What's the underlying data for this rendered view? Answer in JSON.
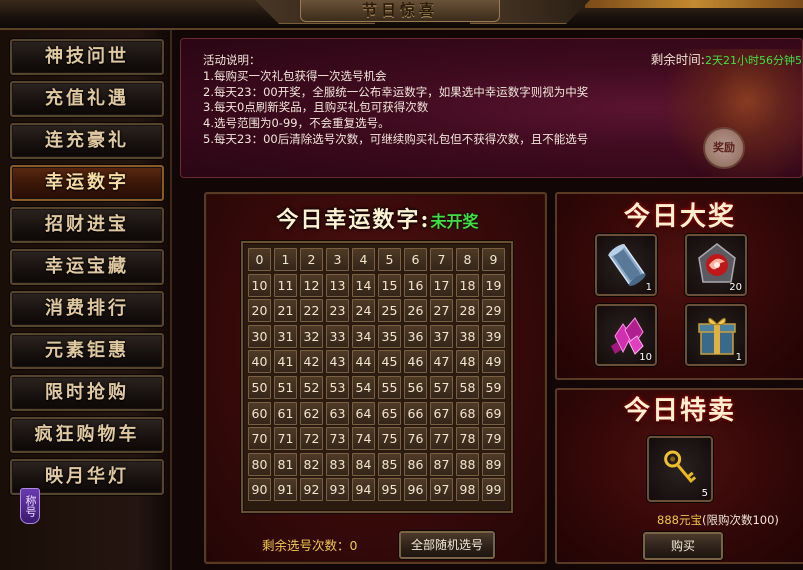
{
  "window": {
    "title": "节日惊喜"
  },
  "sidebar": {
    "items": [
      {
        "label": "神技问世"
      },
      {
        "label": "充值礼遇"
      },
      {
        "label": "连充豪礼"
      },
      {
        "label": "幸运数字"
      },
      {
        "label": "招财进宝"
      },
      {
        "label": "幸运宝藏"
      },
      {
        "label": "消费排行"
      },
      {
        "label": "元素钜惠"
      },
      {
        "label": "限时抢购"
      },
      {
        "label": "疯狂购物车"
      },
      {
        "label": "映月华灯"
      }
    ],
    "active_index": 3,
    "badge": "称号"
  },
  "info": {
    "heading": "活动说明：",
    "lines": [
      "1.每购买一次礼包获得一次选号机会",
      "2.每天23：00开奖，全服统一公布幸运数字，如果选中幸运数字则视为中奖",
      "3.每天0点刷新奖品，且购买礼包可获得次数",
      "4.选号范围为0-99，不会重复选号。",
      "5.每天23：00后清除选号次数，可继续购买礼包但不获得次数，且不能选号"
    ],
    "countdown_label": "剩余时间:",
    "countdown_value": "2天21小时56分钟5",
    "seal_text": "奖励"
  },
  "lucky": {
    "title": "今日幸运数字:",
    "status": "未开奖",
    "numbers": [
      "0",
      "1",
      "2",
      "3",
      "4",
      "5",
      "6",
      "7",
      "8",
      "9",
      "10",
      "11",
      "12",
      "13",
      "14",
      "15",
      "16",
      "17",
      "18",
      "19",
      "20",
      "21",
      "22",
      "23",
      "24",
      "25",
      "26",
      "27",
      "28",
      "29",
      "30",
      "31",
      "32",
      "33",
      "34",
      "35",
      "36",
      "37",
      "38",
      "39",
      "40",
      "41",
      "42",
      "43",
      "44",
      "45",
      "46",
      "47",
      "48",
      "49",
      "50",
      "51",
      "52",
      "53",
      "54",
      "55",
      "56",
      "57",
      "58",
      "59",
      "60",
      "61",
      "62",
      "63",
      "64",
      "65",
      "66",
      "67",
      "68",
      "69",
      "70",
      "71",
      "72",
      "73",
      "74",
      "75",
      "76",
      "77",
      "78",
      "79",
      "80",
      "81",
      "82",
      "83",
      "84",
      "85",
      "86",
      "87",
      "88",
      "89",
      "90",
      "91",
      "92",
      "93",
      "94",
      "95",
      "96",
      "97",
      "98",
      "99"
    ],
    "remaining_label": "剩余选号次数：",
    "remaining_value": "0",
    "random_button": "全部随机选号"
  },
  "prize": {
    "title": "今日大奖",
    "items": [
      {
        "icon": "scroll-icon",
        "qty": "1"
      },
      {
        "icon": "red-swirl-gem-icon",
        "qty": "20"
      },
      {
        "icon": "pink-crystal-icon",
        "qty": "10"
      },
      {
        "icon": "gift-box-icon",
        "qty": "1"
      }
    ]
  },
  "sale": {
    "title": "今日特卖",
    "item": {
      "icon": "golden-key-icon",
      "qty": "5"
    },
    "price": "888元宝",
    "limit": "(限购次数100)",
    "buy_button": "购买"
  },
  "colors": {
    "accent_gold": "#f0c850",
    "status_green": "#40e040",
    "panel_red": "#3a0a0a"
  }
}
